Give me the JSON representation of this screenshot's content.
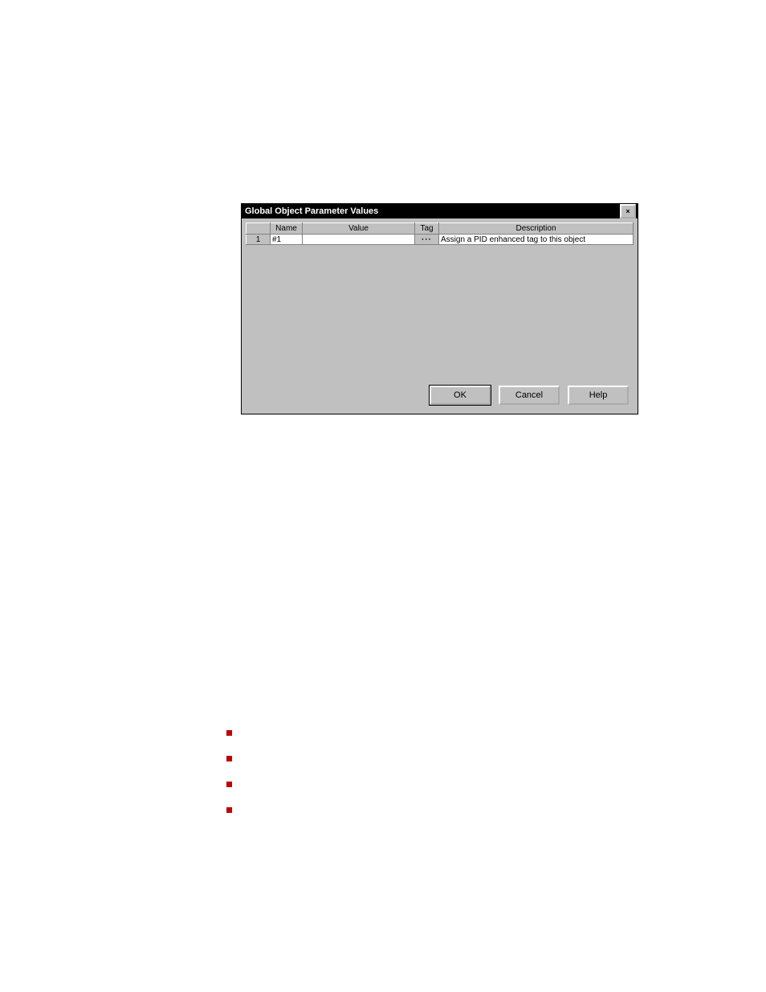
{
  "dialog": {
    "title": "Global Object Parameter Values",
    "close_label": "×",
    "columns": {
      "index": "",
      "name": "Name",
      "value": "Value",
      "tag": "Tag",
      "description": "Description"
    },
    "rows": [
      {
        "index": "1",
        "name": "#1",
        "value": "",
        "tag": "···",
        "description": "Assign a PID enhanced tag to this object"
      }
    ],
    "buttons": {
      "ok": "OK",
      "cancel": "Cancel",
      "help": "Help"
    }
  }
}
